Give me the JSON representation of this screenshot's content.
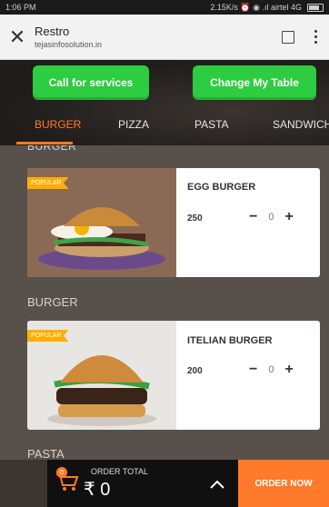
{
  "status_bar": {
    "time": "1:06 PM",
    "right": "2.15K/s  ⏰  ◉  .ıl  airtel 4G"
  },
  "browser": {
    "title": "Restro",
    "url": "tejasinfosolution.in"
  },
  "actions": {
    "services": "Call for services",
    "table": "Change My Table"
  },
  "tabs": [
    "BURGER",
    "PIZZA",
    "PASTA",
    "SANDWICH"
  ],
  "active_tab": "BURGER",
  "section_top": "BURGER",
  "items": [
    {
      "badge": "POPULAR",
      "name": "EGG BURGER",
      "price": "250",
      "qty": "0"
    },
    {
      "badge": "POPULAR",
      "name": "ITELIAN BURGER",
      "price": "200",
      "qty": "0"
    }
  ],
  "sections": {
    "burger": "BURGER",
    "pasta": "PASTA"
  },
  "order": {
    "badge": "0",
    "label": "ORDER TOTAL",
    "amount": "₹ 0",
    "button": "ORDER NOW"
  },
  "colors": {
    "accent": "#ff7a2a",
    "green": "#2ecc40"
  }
}
